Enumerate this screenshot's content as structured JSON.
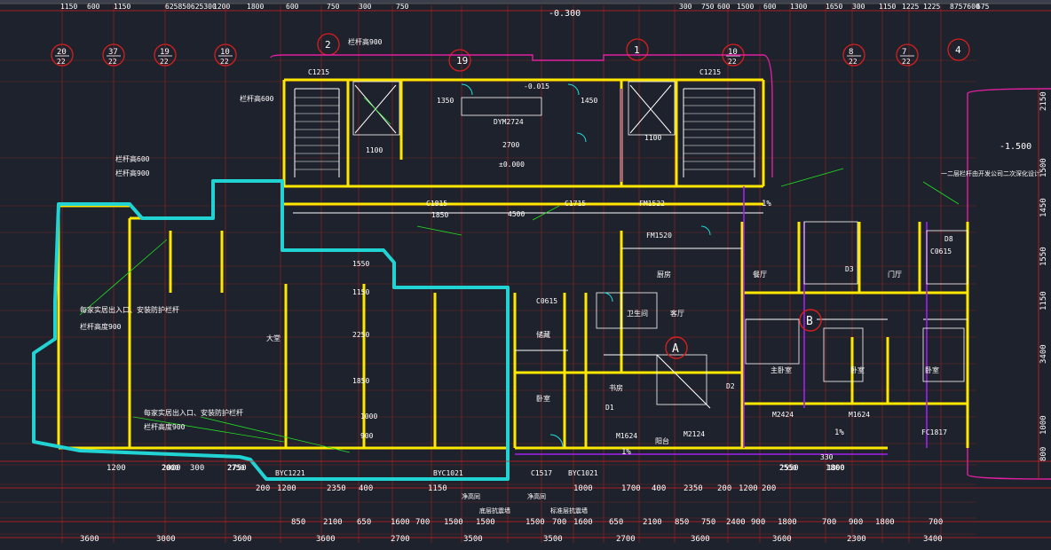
{
  "colors": {
    "background": "#1e222c",
    "dimension_line": "#d41f1f",
    "axis_circle": "#d41f1f",
    "wall": "#ffe800",
    "outline": "#ffffff",
    "label_green": "#22e022",
    "door_cyan": "#1ee0e0",
    "purple": "#a020f0",
    "magenta": "#e020a0",
    "highlight": "#22d3d3",
    "text_white": "#ffffff"
  },
  "top_dimensions": [
    "1150",
    "600",
    "1150",
    "625850625300",
    "1200",
    "1800",
    "600",
    "750",
    "300",
    "750",
    "300",
    "750",
    "600",
    "1500",
    "600",
    "1300",
    "1650",
    "300",
    "1150",
    "1225",
    "1225",
    "8757600",
    "675"
  ],
  "axis_markers": [
    "20\n22",
    "37\n22",
    "19\n22",
    "10\n22",
    "19",
    "10\n22",
    "8\n22",
    "7\n22",
    "2",
    "1",
    "4"
  ],
  "elevation_top": "-0.300",
  "left_annotations": [
    {
      "text": "每家实居出入口、安装防护栏杆"
    },
    {
      "text": "栏杆高度900"
    },
    {
      "text": "每家实居出入口、安装防护栏杆"
    },
    {
      "text": "栏杆高度900"
    }
  ],
  "rooms": {
    "a_unit": "A",
    "b_unit": "B",
    "living": "客厅",
    "dining": "餐厅",
    "bedroom": "卧室",
    "master": "主卧室",
    "kitchen": "厨房",
    "bath": "卫生间",
    "study": "书房",
    "balcony": "阳台",
    "hall": "门厅",
    "lobby": "大堂",
    "storage": "储藏"
  },
  "tags": [
    "C1215",
    "C1215",
    "DYM2724",
    "1350",
    "1100",
    "2700",
    "±0.000",
    "-0.015",
    "1450",
    "1100",
    "FM1522",
    "FM1520",
    "C1815",
    "C1715",
    "4500",
    "1850",
    "1550",
    "1150",
    "2250",
    "1850",
    "1000",
    "900",
    "BYC1221",
    "BYC1021",
    "BYC1021",
    "C1517",
    "C0615",
    "C0615",
    "M2424",
    "M1624",
    "M2124",
    "M1624",
    "D1",
    "D2",
    "D3",
    "D8",
    "FC1817",
    "2000",
    "2750",
    "2550",
    "1800",
    "330"
  ],
  "bottom_row1": [
    "1200",
    "2000",
    "300",
    "2750",
    "2550",
    "1800"
  ],
  "bottom_row2": [
    "200",
    "1200",
    "2350",
    "400",
    "1150",
    "1000",
    "1700",
    "400",
    "2350",
    "200",
    "1200",
    "200"
  ],
  "bottom_row3": [
    "850",
    "2100",
    "650",
    "1600",
    "700",
    "1500",
    "1500",
    "1500",
    "700",
    "1600",
    "650",
    "2100",
    "850",
    "750",
    "2400",
    "900",
    "1800",
    "700",
    "900",
    "1800",
    "700"
  ],
  "bottom_row4": [
    "3600",
    "3000",
    "3600",
    "3600",
    "2700",
    "3500",
    "3500",
    "2700",
    "3600",
    "3600",
    "2300",
    "3400"
  ],
  "bottom_labels": [
    "净高同",
    "净高同",
    "底层抗震墙",
    "标准层抗震墙"
  ],
  "right_dims": [
    "2150",
    "1500",
    "1450",
    "1550",
    "1150",
    "3400",
    "1000",
    "800"
  ],
  "elevation_right": "-1.500",
  "percent_marks": [
    "1%",
    "1%",
    "1%"
  ],
  "right_note": "一二层栏杆由开发公司二次深化设计",
  "guard_notes": [
    "栏杆高600",
    "栏杆高900",
    "栏杆高600",
    "栏杆高900"
  ]
}
